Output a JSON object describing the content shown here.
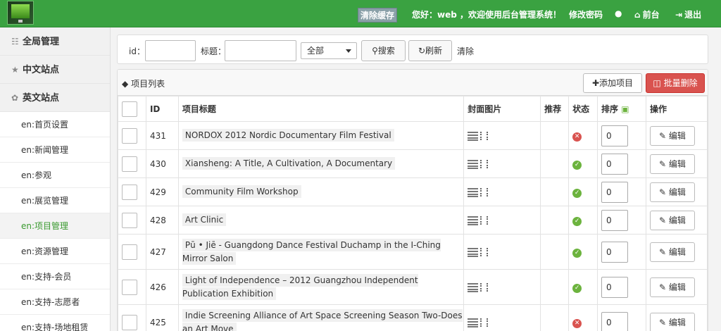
{
  "topbar": {
    "clear_cache": "清除缓存",
    "greeting": "您好：web ，欢迎使用后台管理系统！",
    "change_password": "修改密码",
    "front": "前台",
    "logout": "退出"
  },
  "sidebar": {
    "groups": [
      {
        "label": "全局管理",
        "icon": "sitemap-icon"
      },
      {
        "label": "中文站点",
        "icon": "star-icon"
      },
      {
        "label": "英文站点",
        "icon": "twitter-icon"
      }
    ],
    "items": [
      {
        "label": "en:首页设置"
      },
      {
        "label": "en:新闻管理"
      },
      {
        "label": "en:参观"
      },
      {
        "label": "en:展览管理"
      },
      {
        "label": "en:项目管理",
        "active": true
      },
      {
        "label": "en:资源管理"
      },
      {
        "label": "en:支持-会员"
      },
      {
        "label": "en:支持-志愿者"
      },
      {
        "label": "en:支持-场地租赁"
      }
    ]
  },
  "search": {
    "id_label": "id：",
    "title_label": "标题：",
    "id_value": "",
    "title_value": "",
    "category_selected": "全部",
    "search_button": "搜索",
    "refresh_button": "刷新",
    "clear_link": "清除"
  },
  "list": {
    "title": "项目列表",
    "add_button": "添加项目",
    "batch_delete_button": "批量删除",
    "columns": {
      "id": "ID",
      "title": "项目标题",
      "cover": "封面图片",
      "recommend": "推荐",
      "status": "状态",
      "sort": "排序",
      "action": "操作"
    },
    "edit_label": "编辑",
    "rows": [
      {
        "id": "431",
        "title": "NORDOX 2012 Nordic Documentary Film Festival",
        "status": "inactive",
        "sort": "0"
      },
      {
        "id": "430",
        "title": "Xiansheng: A Title, A Cultivation, A Documentary",
        "status": "active",
        "sort": "0"
      },
      {
        "id": "429",
        "title": "Community Film Workshop",
        "status": "active",
        "sort": "0"
      },
      {
        "id": "428",
        "title": "Art Clinic",
        "status": "active",
        "sort": "0"
      },
      {
        "id": "427",
        "title": "Pū • Jiē - Guangdong Dance Festival Duchamp in the I-Ching Mirror Salon",
        "status": "active",
        "sort": "0"
      },
      {
        "id": "426",
        "title": "Light of Independence – 2012 Guangzhou Independent Publication Exhibition",
        "status": "active",
        "sort": "0"
      },
      {
        "id": "425",
        "title": "Indie Screening Alliance of Art Space Screening Season Two-Does an Art Move",
        "status": "inactive",
        "sort": "0"
      }
    ]
  },
  "colors": {
    "topbar": "#3aa241",
    "active_nav": "#3a9a2f",
    "danger": "#d9534f",
    "ok": "#6cb33e"
  }
}
